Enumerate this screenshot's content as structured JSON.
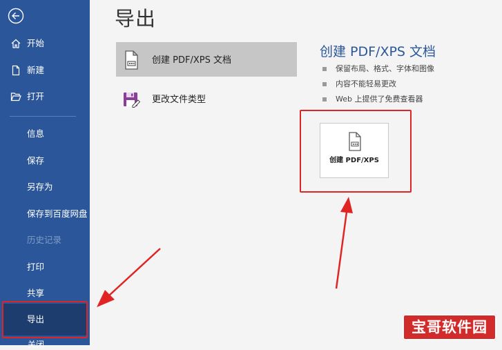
{
  "sidebar": {
    "items": [
      {
        "label": "开始"
      },
      {
        "label": "新建"
      },
      {
        "label": "打开"
      },
      {
        "label": "信息"
      },
      {
        "label": "保存"
      },
      {
        "label": "另存为"
      },
      {
        "label": "保存到百度网盘"
      },
      {
        "label": "历史记录"
      },
      {
        "label": "打印"
      },
      {
        "label": "共享"
      },
      {
        "label": "导出"
      },
      {
        "label": "关闭"
      }
    ],
    "selected": "导出"
  },
  "main": {
    "title": "导出",
    "options": [
      {
        "label": "创建 PDF/XPS 文档"
      },
      {
        "label": "更改文件类型"
      }
    ]
  },
  "detail": {
    "title": "创建 PDF/XPS 文档",
    "bullets": [
      "保留布局、格式、字体和图像",
      "内容不能轻易更改",
      "Web 上提供了免费查看器"
    ],
    "button_label": "创建 PDF/XPS"
  },
  "watermark": "宝哥软件园",
  "colors": {
    "sidebar": "#2b579a",
    "accent": "#2b579a",
    "highlight": "#e02424"
  }
}
